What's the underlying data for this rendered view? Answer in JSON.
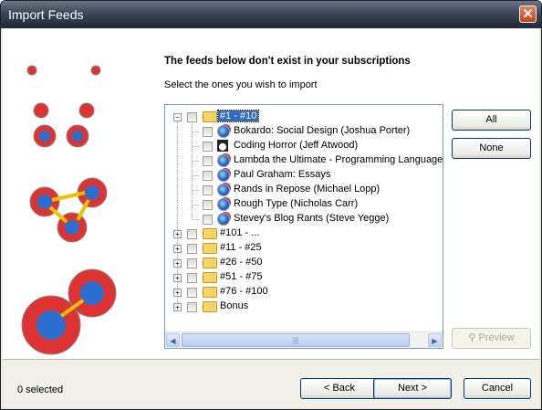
{
  "window": {
    "title": "Import Feeds"
  },
  "heading": "The feeds below don't exist in your subscriptions",
  "subheading": "Select the ones you wish to import",
  "tree": {
    "groups": [
      {
        "label": "#1 - #10",
        "expanded": true,
        "selected": true,
        "items": [
          {
            "label": "Bokardo: Social Design (Joshua Porter)",
            "icon": "globe-feed-icon"
          },
          {
            "label": "Coding Horror (Jeff Atwood)",
            "icon": "avatar-feed-icon"
          },
          {
            "label": "Lambda the Ultimate - Programming Languages",
            "icon": "globe-feed-icon"
          },
          {
            "label": "Paul Graham: Essays",
            "icon": "globe-feed-icon"
          },
          {
            "label": "Rands in Repose (Michael Lopp)",
            "icon": "globe-feed-icon"
          },
          {
            "label": "Rough Type (Nicholas Carr)",
            "icon": "globe-feed-icon"
          },
          {
            "label": "Stevey's Blog Rants (Steve Yegge)",
            "icon": "globe-feed-icon"
          }
        ]
      },
      {
        "label": "#101 - ..."
      },
      {
        "label": "#11 - #25"
      },
      {
        "label": "#26 - #50"
      },
      {
        "label": "#51 - #75"
      },
      {
        "label": "#76 - #100"
      },
      {
        "label": "Bonus"
      }
    ]
  },
  "buttons": {
    "all": "All",
    "none": "None",
    "preview": "Preview",
    "back": "< Back",
    "next": "Next >",
    "cancel": "Cancel"
  },
  "status": "0 selected"
}
